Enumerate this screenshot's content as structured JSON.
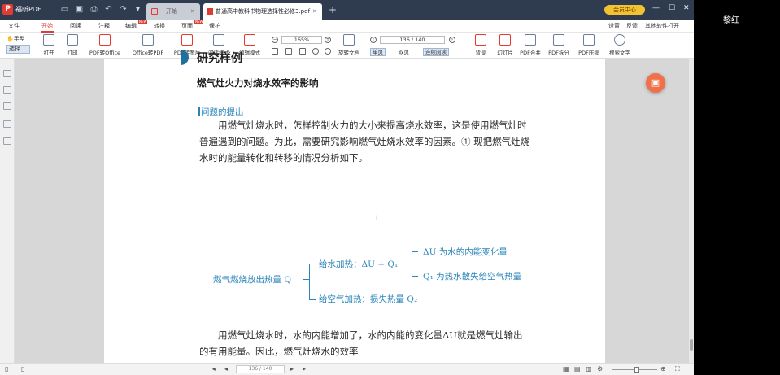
{
  "app": {
    "name": "福昕PDF",
    "logo_letter": "P",
    "brand_color": "#e03c31"
  },
  "tabs": [
    {
      "label": "开始",
      "active": false
    },
    {
      "label": "普通高中教科书物理选择性必修3.pdf",
      "active": true
    }
  ],
  "titlebar": {
    "vip_label": "会员中心",
    "new_tab": "+"
  },
  "menu": {
    "items": [
      "文件",
      "开始",
      "阅读",
      "注释",
      "编辑",
      "转换",
      "页面",
      "保护"
    ],
    "active": "开始",
    "new_badge": "NEW",
    "right_items": [
      "设置",
      "反馈",
      "其他软件打开"
    ]
  },
  "toolbar": {
    "hand": "手型",
    "select": "选择",
    "tools_left": [
      "打开",
      "打印",
      "PDF转Office",
      "Office转PDF",
      "PDF转图片",
      "阅读模式",
      "编辑模式"
    ],
    "zoom": "165%",
    "rotate_label": "旋转文档",
    "page_indicator": "136 / 140",
    "view_modes": [
      "单页",
      "双页",
      "连续阅读"
    ],
    "tools_right": [
      "背景",
      "幻灯片",
      "PDF合并",
      "PDF拆分",
      "PDF压缩",
      "搜索文字"
    ]
  },
  "document": {
    "section_title": "研究样例",
    "article_title": "燃气灶火力对烧水效率的影响",
    "question_heading": "问题的提出",
    "paragraph1": "用燃气灶烧水时，怎样控制火力的大小来提高烧水效率，这是使用燃气灶时普遍遇到的问题。为此，需要研究影响燃气灶烧水效率的因素。① 现把燃气灶烧水时的能量转化和转移的情况分析如下。",
    "figure": {
      "root": "燃气燃烧放出热量 Q",
      "branch_top": "给水加热：ΔU + Q₁",
      "branch_bottom": "给空气加热：损失热量 Q₂",
      "sub_top": "ΔU 为水的内能变化量",
      "sub_bottom": "Q₁ 为热水散失给空气热量"
    },
    "paragraph2": "用燃气灶烧水时，水的内能增加了，水的内能的变化量ΔU就是燃气灶输出的有用能量。因此，燃气灶烧水的效率"
  },
  "status": {
    "page": "136 / 140",
    "zoom": "165%"
  },
  "user": {
    "name": "黎红"
  }
}
